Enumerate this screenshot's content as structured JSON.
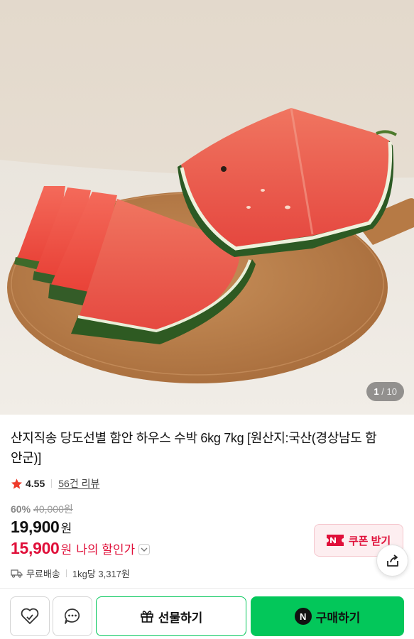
{
  "product_image": {
    "alt": "",
    "counter_current": "1",
    "counter_separator": "/",
    "counter_total": "10"
  },
  "product": {
    "title": "산지직송 당도선별 함안 하우스 수박 6kg 7kg [원산지:국산(경상남도 함안군)]",
    "rating": "4.55",
    "review_link": "56건 리뷰",
    "discount_rate": "60%",
    "original_price": "40,000원",
    "sale_price": "19,900",
    "sale_unit": "원",
    "my_price": "15,900",
    "my_price_unit": "원",
    "my_price_label": "나의 할인가",
    "coupon_label": "쿠폰 받기",
    "delivery": "무료배송",
    "unit_price": "1kg당 3,317원"
  },
  "bottom_bar": {
    "gift_label": "선물하기",
    "buy_label": "구매하기",
    "npay_icon_text": "N"
  },
  "colors": {
    "accent_red": "#e0103a",
    "naver_green": "#03c75a",
    "star": "#ee3b2b"
  },
  "icons": [
    "star-icon",
    "chevron-down-icon",
    "coupon-icon",
    "share-icon",
    "truck-icon",
    "heart-icon",
    "chat-icon",
    "gift-icon",
    "npay-icon"
  ]
}
